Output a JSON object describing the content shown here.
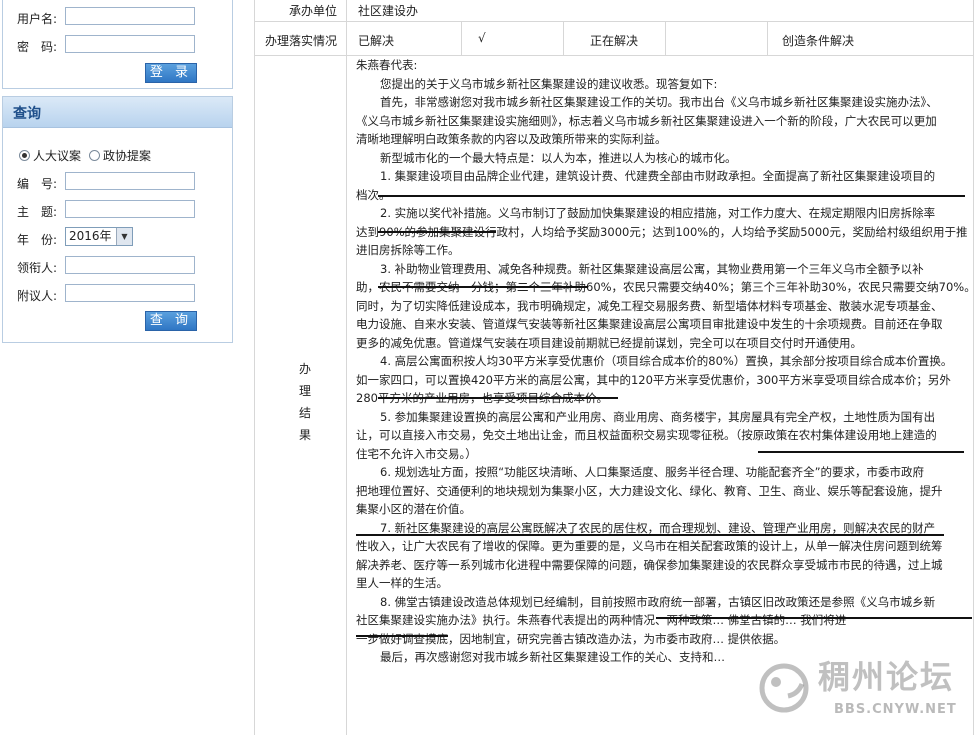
{
  "login": {
    "username_label": "用户名:",
    "password_label": "密　码:",
    "username_value": "",
    "password_value": "",
    "login_button": "登 录"
  },
  "query": {
    "title": "查询",
    "radio_options": [
      "人大议案",
      "政协提案"
    ],
    "selected_radio": "人大议案",
    "number_label": "编　号:",
    "subject_label": "主　题:",
    "year_label": "年　份:",
    "year_value": "2016年",
    "leader_label": "领衔人:",
    "cosigner_label": "附议人:",
    "query_button": "查 询"
  },
  "table": {
    "undertaker_label": "承办单位",
    "undertaker_value": "社区建设办",
    "status_label": "办理落实情况",
    "status_options": [
      "已解决",
      "√",
      "正在解决",
      "创造条件解决"
    ],
    "result_label": [
      "办",
      "理",
      "结",
      "果"
    ]
  },
  "result_lines": [
    {
      "text": "朱燕春代表:",
      "indent": false
    },
    {
      "text": "您提出的关于义乌市城乡新社区集聚建设的建议收悉。现答复如下:",
      "indent": true
    },
    {
      "text": "首先，非常感谢您对我市城乡新社区集聚建设工作的关切。我市出台《义乌市城乡新社区集聚建设实施办法》、",
      "indent": true
    },
    {
      "text": "《义乌市城乡新社区集聚建设实施细则》，标志着义乌市城乡新社区集聚建设进入一个新的阶段，广大农民可以更加",
      "indent": false
    },
    {
      "text": "清晰地理解明白政策条款的内容以及政策所带来的实际利益。",
      "indent": false
    },
    {
      "text": "新型城市化的一个最大特点是：以人为本，推进以人为核心的城市化。",
      "indent": true
    },
    {
      "text": "1. 集聚建设项目由品牌企业代建，建筑设计费、代建费全部由市财政承担。全面提高了新社区集聚建设项目的",
      "indent": true
    },
    {
      "text": "档次。",
      "indent": false
    },
    {
      "text": "2. 实施以奖代补措施。义乌市制订了鼓励加快集聚建设的相应措施，对工作力度大、在规定期限内旧房拆除率",
      "indent": true
    },
    {
      "text": "达到90%的参加集聚建设行政村，人均给予奖励3000元；达到100%的，人均给予奖励5000元，奖励给村级组织用于推",
      "indent": false
    },
    {
      "text": "进旧房拆除等工作。",
      "indent": false
    },
    {
      "text": "3. 补助物业管理费用、减免各种规费。新社区集聚建设高层公寓，其物业费用第一个三年义乌市全额予以补",
      "indent": true
    },
    {
      "text": "助，农民不需要交纳一分钱；第二个三年补助60%，农民只需要交纳40%；第三个三年补助30%，农民只需要交纳70%。",
      "indent": false
    },
    {
      "text": "同时，为了切实降低建设成本，我市明确规定，减免工程交易服务费、新型墙体材料专项基金、散装水泥专项基金、",
      "indent": false
    },
    {
      "text": "电力设施、自来水安装、管道煤气安装等新社区集聚建设高层公寓项目审批建设中发生的十余项规费。目前还在争取",
      "indent": false
    },
    {
      "text": "更多的减免优惠。管道煤气安装在项目建设前期就已经提前谋划，完全可以在项目交付时开通使用。",
      "indent": false
    },
    {
      "text": "4. 高层公寓面积按人均30平方米享受优惠价（项目综合成本价的80%）置换，其余部分按项目综合成本价置换。",
      "indent": true
    },
    {
      "text": "如一家四口，可以置换420平方米的高层公寓，其中的120平方米享受优惠价，300平方米享受项目综合成本价；另外",
      "indent": false
    },
    {
      "text": "280平方米的产业用房，也享受项目综合成本价。",
      "indent": false
    },
    {
      "text": "5. 参加集聚建设置换的高层公寓和产业用房、商业用房、商务楼宇，其房屋具有完全产权，土地性质为国有出",
      "indent": true
    },
    {
      "text": "让，可以直接入市交易，免交土地出让金，而且权益面积交易实现零征税。（按原政策在农村集体建设用地上建造的",
      "indent": false
    },
    {
      "text": "住宅不允许入市交易。）",
      "indent": false
    },
    {
      "text": "6. 规划选址方面，按照“功能区块清晰、人口集聚适度、服务半径合理、功能配套齐全”的要求，市委市政府",
      "indent": true
    },
    {
      "text": "把地理位置好、交通便利的地块规划为集聚小区，大力建设文化、绿化、教育、卫生、商业、娱乐等配套设施，提升",
      "indent": false
    },
    {
      "text": "集聚小区的潜在价值。",
      "indent": false
    },
    {
      "text": "7. 新社区集聚建设的高层公寓既解决了农民的居住权，而合理规划、建设、管理产业用房，则解决农民的财产",
      "indent": true
    },
    {
      "text": "性收入，让广大农民有了增收的保障。更为重要的是，义乌市在相关配套政策的设计上，从单一解决住房问题到统筹",
      "indent": false
    },
    {
      "text": "解决养老、医疗等一系列城市化进程中需要保障的问题，确保参加集聚建设的农民群众享受城市市民的待遇，过上城",
      "indent": false
    },
    {
      "text": "里人一样的生活。",
      "indent": false
    },
    {
      "text": "8. 佛堂古镇建设改造总体规划已经编制，目前按照市政府统一部署，古镇区旧改政策还是参照《义乌市城乡新",
      "indent": true
    },
    {
      "text": "社区集聚建设实施办法》执行。朱燕春代表提出的两种情况、两种政策… 佛堂古镇的… 我们将进",
      "indent": false
    },
    {
      "text": "一步做好调查摸底，因地制宜，研究完善古镇改造办法，为市委市政府… 提供依据。",
      "indent": false
    },
    {
      "text": "最后，再次感谢您对我市城乡新社区集聚建设工作的关心、支持和…",
      "indent": true
    }
  ],
  "watermark": {
    "title": "稠州论坛",
    "url": "BBS.CNYW.NET"
  }
}
